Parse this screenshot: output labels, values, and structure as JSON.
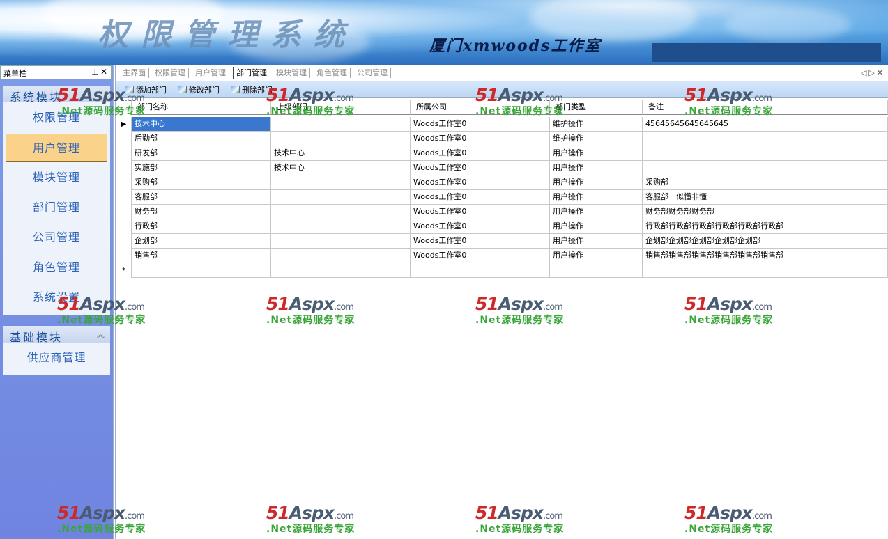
{
  "banner": {
    "title": "权限管理系统",
    "subtitle": "厦门xmwoods工作室"
  },
  "sidebar": {
    "header_label": "菜单栏",
    "pin_icon": "pin-icon",
    "close_icon": "close-icon",
    "groups": [
      {
        "title": "系统模块",
        "items": [
          "权限管理",
          "用户管理",
          "模块管理",
          "部门管理",
          "公司管理",
          "角色管理",
          "系统设置"
        ],
        "active_item": "用户管理"
      },
      {
        "title": "基础模块",
        "items": [
          "供应商管理"
        ]
      }
    ]
  },
  "tabs": {
    "items": [
      "主界面",
      "权限管理",
      "用户管理",
      "部门管理",
      "模块管理",
      "角色管理",
      "公司管理"
    ],
    "active": "部门管理"
  },
  "toolbar": {
    "add": "添加部门",
    "edit": "修改部门",
    "delete": "删除部门"
  },
  "grid": {
    "columns": [
      "部门名称",
      "上级部门",
      "所属公司",
      "部门类型",
      "备注"
    ],
    "rows": [
      [
        "技术中心",
        "",
        "Woods工作室0",
        "维护操作",
        "45645645645645645"
      ],
      [
        "后勤部",
        "",
        "Woods工作室0",
        "维护操作",
        ""
      ],
      [
        "研发部",
        "技术中心",
        "Woods工作室0",
        "用户操作",
        ""
      ],
      [
        "实施部",
        "技术中心",
        "Woods工作室0",
        "用户操作",
        ""
      ],
      [
        "采购部",
        "",
        "Woods工作室0",
        "用户操作",
        "采购部"
      ],
      [
        "客服部",
        "",
        "Woods工作室0",
        "用户操作",
        "客服部　似懂非懂"
      ],
      [
        "财务部",
        "",
        "Woods工作室0",
        "用户操作",
        "财务部财务部财务部"
      ],
      [
        "行政部",
        "",
        "Woods工作室0",
        "用户操作",
        "行政部行政部行政部行政部行政部行政部"
      ],
      [
        "企划部",
        "",
        "Woods工作室0",
        "用户操作",
        "企划部企划部企划部企划部企划部"
      ],
      [
        "销售部",
        "",
        "Woods工作室0",
        "用户操作",
        "销售部销售部销售部销售部销售部销售部"
      ]
    ],
    "current_row_marker": "▶",
    "new_row_marker": "*"
  },
  "watermark": {
    "brand_num": "51",
    "brand_word": "Aspx",
    "brand_domain": ".com",
    "tagline": ".Net源码服务专家"
  }
}
